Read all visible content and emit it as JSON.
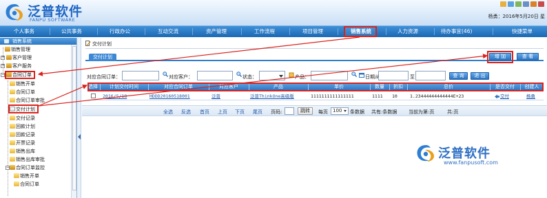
{
  "app": {
    "brand_cn": "泛普软件",
    "brand_en": "FANPU SOFTWARE",
    "user_line": "杨勇：2016年5月20日 星",
    "colors": {
      "nav": "#2b77c2",
      "accent": "#d9221c",
      "link": "#1d55a8"
    }
  },
  "nav": {
    "items": [
      "个人事务",
      "公共事务",
      "行政办公",
      "互动交流",
      "资产管理",
      "工作流程",
      "项目管理",
      "销售系统",
      "人力资源",
      "待办事宜(46)",
      "快捷菜单"
    ],
    "active": "销售系统"
  },
  "sidebar": {
    "title": "销售系统",
    "items": [
      "销售管理",
      "客户管理",
      "客户服务",
      "合同订单",
      "销售开单",
      "合同订单",
      "合同订单审批",
      "交付计划",
      "交付记录",
      "回款计划",
      "回款记录",
      "开票记录",
      "销售出库",
      "销售出库审批",
      "合同订单监控",
      "销售开单",
      "合同订单"
    ],
    "active": "交付计划"
  },
  "main": {
    "title": "交付计划",
    "tab": "交付计划",
    "add_button": "增 加",
    "view_button": "查 看",
    "filters": {
      "order_label": "对应合同订单：",
      "customer_label": "对应客户：",
      "status_label": "状态：",
      "product_label": "产品：",
      "date_label": "日期从",
      "date_to": "至",
      "query_button": "查 询",
      "exit_button": "退 出"
    },
    "table": {
      "headers": [
        "选择",
        "计划交付时间",
        "对应合同订单",
        "对应客户",
        "产品",
        "单价",
        "数量",
        "折扣",
        "总价",
        "是否交付",
        "创建人"
      ],
      "rows": [
        {
          "date": "2016/5/18",
          "order": "HDDD20160518001",
          "customer": "泛普",
          "product": "泛普ThinkOne高级版",
          "price": "1111111111111111",
          "qty": "1111",
          "discount": "10",
          "total": "1.23444444444444E+23",
          "delivered": "交付",
          "creator": "杨勇"
        }
      ]
    },
    "pager": {
      "select_all": "全选",
      "invert": "反选",
      "first": "首页",
      "prev": "上页",
      "next": "下页",
      "last": "尾页",
      "page_label": "页码:",
      "jump": "跳转",
      "per_page_label": "每页",
      "per_page_value": "100",
      "per_page_suffix": "条数据",
      "total": "共有:条数据",
      "current": "当前为第:页",
      "pages": "共:页"
    }
  },
  "watermark": {
    "text": "泛普软件",
    "url": "www.fanpusoft.com"
  }
}
